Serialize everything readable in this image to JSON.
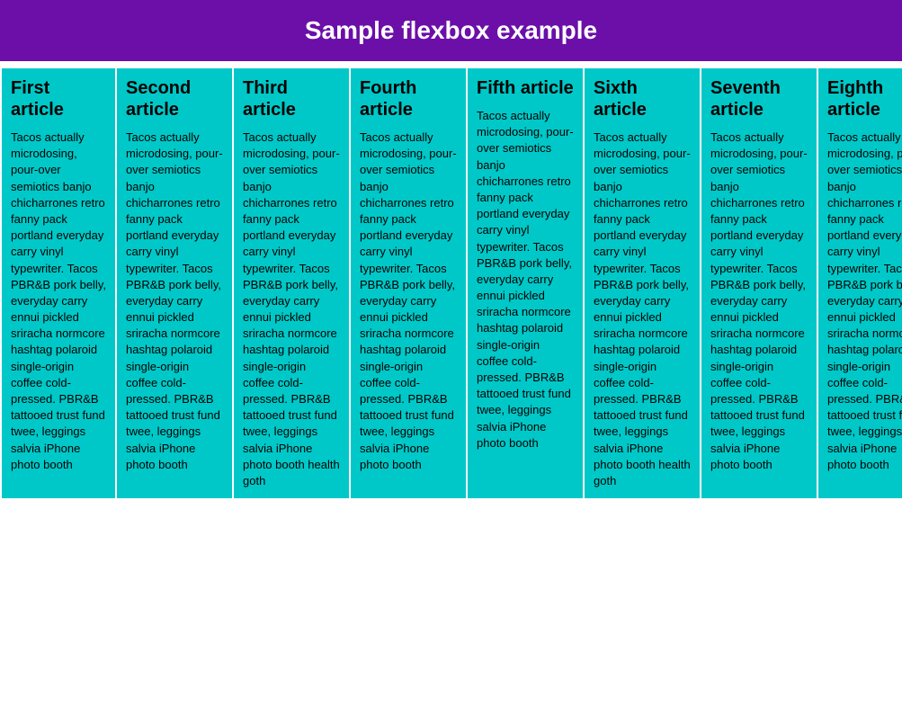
{
  "header": {
    "title": "Sample flexbox example",
    "bg_color": "#6b0fa8"
  },
  "articles": [
    {
      "id": "first",
      "title": "First article",
      "body": "Tacos actually microdosing, pour-over semiotics banjo chicharrones retro fanny pack portland everyday carry vinyl typewriter. Tacos PBR&B pork belly, everyday carry ennui pickled sriracha normcore hashtag polaroid single-origin coffee cold-pressed. PBR&B tattooed trust fund twee, leggings salvia iPhone photo booth"
    },
    {
      "id": "second",
      "title": "Second article",
      "body": "Tacos actually microdosing, pour-over semiotics banjo chicharrones retro fanny pack portland everyday carry vinyl typewriter. Tacos PBR&B pork belly, everyday carry ennui pickled sriracha normcore hashtag polaroid single-origin coffee cold-pressed. PBR&B tattooed trust fund twee, leggings salvia iPhone photo booth"
    },
    {
      "id": "third",
      "title": "Third article",
      "body": "Tacos actually microdosing, pour-over semiotics banjo chicharrones retro fanny pack portland everyday carry vinyl typewriter. Tacos PBR&B pork belly, everyday carry ennui pickled sriracha normcore hashtag polaroid single-origin coffee cold-pressed. PBR&B tattooed trust fund twee, leggings salvia iPhone photo booth health goth"
    },
    {
      "id": "fourth",
      "title": "Fourth article",
      "body": "Tacos actually microdosing, pour-over semiotics banjo chicharrones retro fanny pack portland everyday carry vinyl typewriter. Tacos PBR&B pork belly, everyday carry ennui pickled sriracha normcore hashtag polaroid single-origin coffee cold-pressed. PBR&B tattooed trust fund twee, leggings salvia iPhone photo booth"
    },
    {
      "id": "fifth",
      "title": "Fifth article",
      "body": "Tacos actually microdosing, pour-over semiotics banjo chicharrones retro fanny pack portland everyday carry vinyl typewriter. Tacos PBR&B pork belly, everyday carry ennui pickled sriracha normcore hashtag polaroid single-origin coffee cold-pressed. PBR&B tattooed trust fund twee, leggings salvia iPhone photo booth"
    },
    {
      "id": "sixth",
      "title": "Sixth article",
      "body": "Tacos actually microdosing, pour-over semiotics banjo chicharrones retro fanny pack portland everyday carry vinyl typewriter. Tacos PBR&B pork belly, everyday carry ennui pickled sriracha normcore hashtag polaroid single-origin coffee cold-pressed. PBR&B tattooed trust fund twee, leggings salvia iPhone photo booth health goth"
    },
    {
      "id": "seventh",
      "title": "Seventh article",
      "body": "Tacos actually microdosing, pour-over semiotics banjo chicharrones retro fanny pack portland everyday carry vinyl typewriter. Tacos PBR&B pork belly, everyday carry ennui pickled sriracha normcore hashtag polaroid single-origin coffee cold-pressed. PBR&B tattooed trust fund twee, leggings salvia iPhone photo booth"
    },
    {
      "id": "eighth",
      "title": "Eighth article",
      "body": "Tacos actually microdosing, pour-over semiotics banjo chicharrones retro fanny pack portland everyday carry vinyl typewriter. Tacos PBR&B pork belly, everyday carry ennui pickled sriracha normcore hashtag polaroid single-origin coffee cold-pressed. PBR&B tattooed trust fund twee, leggings salvia iPhone photo booth"
    }
  ]
}
